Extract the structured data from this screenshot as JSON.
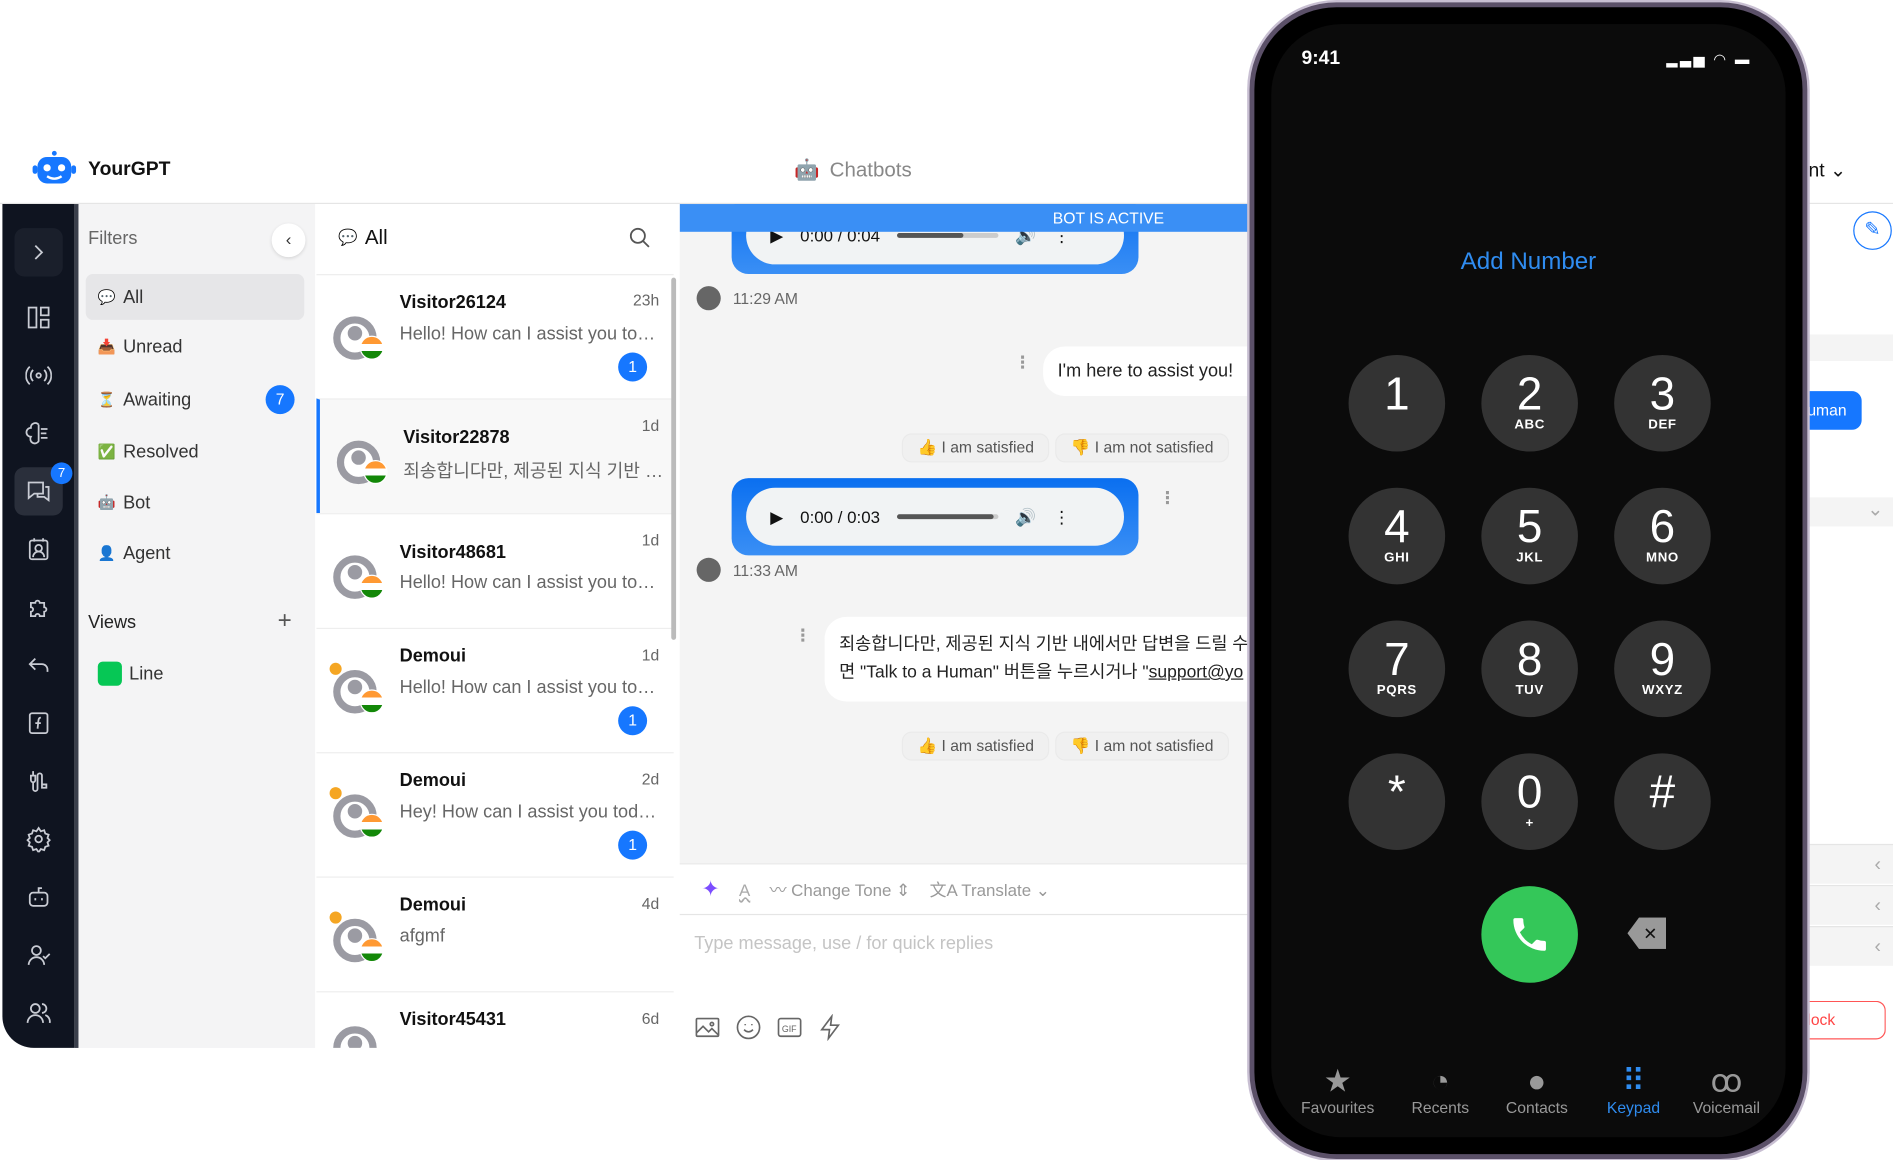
{
  "header": {
    "brand": "YourGPT",
    "center": "Chatbots",
    "right_fragment": "nt"
  },
  "rail": {
    "chat_badge": "7"
  },
  "filters": {
    "title": "Filters",
    "items": [
      {
        "label": "All",
        "icon": "speech-bubble-icon"
      },
      {
        "label": "Unread",
        "icon": "inbox-icon"
      },
      {
        "label": "Awaiting",
        "icon": "hourglass-icon",
        "badge": "7"
      },
      {
        "label": "Resolved",
        "icon": "check-icon"
      },
      {
        "label": "Bot",
        "icon": "robot-icon"
      },
      {
        "label": "Agent",
        "icon": "person-icon"
      }
    ],
    "views_title": "Views",
    "views": [
      {
        "label": "Line"
      }
    ]
  },
  "list": {
    "title": "All",
    "items": [
      {
        "name": "Visitor26124",
        "msg": "Hello! How can I assist you today?",
        "time": "23h",
        "badge": "1",
        "dot": false
      },
      {
        "name": "Visitor22878",
        "msg": "죄송합니다만, 제공된 지식 기반 내에서만",
        "time": "1d",
        "badge": "",
        "dot": false,
        "selected": true
      },
      {
        "name": "Visitor48681",
        "msg": "Hello! How can I assist you today?",
        "time": "1d",
        "badge": "",
        "dot": false
      },
      {
        "name": "Demoui",
        "msg": "Hello! How can I assist you today?",
        "time": "1d",
        "badge": "1",
        "dot": true
      },
      {
        "name": "Demoui",
        "msg": "Hey! How can I assist you today?",
        "time": "2d",
        "badge": "1",
        "dot": true
      },
      {
        "name": "Demoui",
        "msg": "afgmf",
        "time": "4d",
        "badge": "",
        "dot": true
      },
      {
        "name": "Visitor45431",
        "msg": "",
        "time": "6d",
        "badge": "",
        "dot": false
      }
    ]
  },
  "chat": {
    "status": "BOT IS ACTIVE",
    "audio1": {
      "time": "0:00 / 0:04",
      "progress": 0.65
    },
    "ts1": "11:29 AM",
    "bot_msg1": "I'm here to assist you!",
    "satisfied": "I am satisfied",
    "not_satisfied": "I am not satisfied",
    "audio2": {
      "time": "0:00 / 0:03",
      "progress": 0.95
    },
    "ts2": "11:33 AM",
    "bot_msg2_line1": "죄송합니다만, 제공된 지식 기반 내에서만 답변을 드릴 수 있",
    "bot_msg2_line2": "면 \"Talk to a Human\" 버튼을 누르시거나 \"",
    "bot_msg2_link": "support@yo"
  },
  "composer": {
    "change_tone": "Change Tone",
    "translate": "Translate",
    "placeholder": "Type message, use / for quick replies"
  },
  "right_panel": {
    "human_btn": "uman",
    "block_btn": "lock"
  },
  "phone": {
    "time": "9:41",
    "add_number": "Add Number",
    "keys": [
      {
        "d": "1",
        "l": ""
      },
      {
        "d": "2",
        "l": "ABC"
      },
      {
        "d": "3",
        "l": "DEF"
      },
      {
        "d": "4",
        "l": "GHI"
      },
      {
        "d": "5",
        "l": "JKL"
      },
      {
        "d": "6",
        "l": "MNO"
      },
      {
        "d": "7",
        "l": "PQRS"
      },
      {
        "d": "8",
        "l": "TUV"
      },
      {
        "d": "9",
        "l": "WXYZ"
      },
      {
        "d": "*",
        "l": ""
      },
      {
        "d": "0",
        "l": "+"
      },
      {
        "d": "#",
        "l": ""
      }
    ],
    "tabs": [
      {
        "label": "Favourites",
        "icon": "star-icon"
      },
      {
        "label": "Recents",
        "icon": "clock-icon"
      },
      {
        "label": "Contacts",
        "icon": "contact-icon"
      },
      {
        "label": "Keypad",
        "icon": "keypad-icon",
        "active": true
      },
      {
        "label": "Voicemail",
        "icon": "voicemail-icon"
      }
    ],
    "accent": "#2f8cf0",
    "call_color": "#34c759"
  },
  "colors": {
    "primary": "#1677ff",
    "bot_bar": "#3a8ff5",
    "rail": "#0f1420"
  }
}
